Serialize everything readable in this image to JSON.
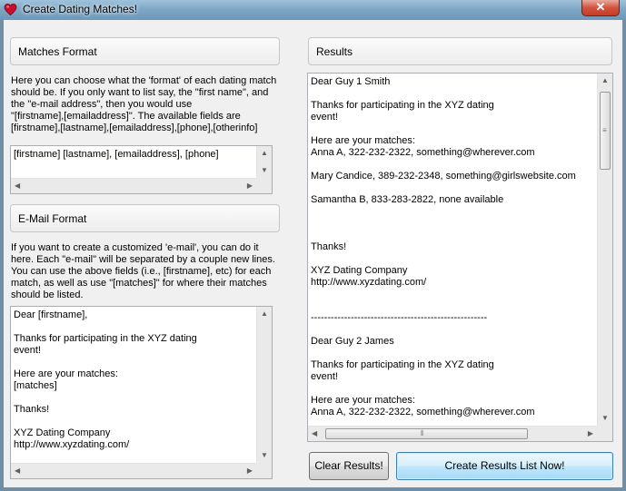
{
  "window": {
    "title": "Create Dating Matches!",
    "close_glyph": "✕"
  },
  "matches_format": {
    "header": "Matches Format",
    "description": "Here you can choose what the 'format' of each dating match\nshould be. If you only want to list say, the \"first name\", and\nthe \"e-mail address\", then you would use\n\"[firstname],[emailaddress]\". The available fields are\n[firstname],[lastname],[emailaddress],[phone],[otherinfo]",
    "value": "[firstname] [lastname], [emailaddress], [phone]"
  },
  "email_format": {
    "header": "E-Mail Format",
    "description": "If you want to create a customized 'e-mail', you can do it\nhere. Each \"e-mail\" will be separated by a couple new lines.\nYou can use the above fields (i.e., [firstname], etc) for each\nmatch, as well as use \"[matches]\" for where their matches\nshould be listed.",
    "value": "Dear [firstname],\n\nThanks for participating in the XYZ dating\nevent!\n\nHere are your matches:\n[matches]\n\nThanks!\n\nXYZ Dating Company\nhttp://www.xyzdating.com/"
  },
  "results": {
    "header": "Results",
    "value": "Dear Guy 1 Smith\n\nThanks for participating in the XYZ dating\nevent!\n\nHere are your matches:\nAnna A, 322-232-2322, something@wherever.com\n\nMary Candice, 389-232-2348, something@girlswebsite.com\n\nSamantha B, 833-283-2822, none available\n\n\n\nThanks!\n\nXYZ Dating Company\nhttp://www.xyzdating.com/\n\n\n-----------------------------------------------------\n\nDear Guy 2 James\n\nThanks for participating in the XYZ dating\nevent!\n\nHere are your matches:\nAnna A, 322-232-2322, something@wherever.com"
  },
  "buttons": {
    "clear": "Clear Results!",
    "create": "Create Results List Now!"
  },
  "colors": {
    "title_bar": "#7ea7c6",
    "close_button": "#c43c25",
    "app_icon": "#c8102e",
    "primary_button": "#bee6fd"
  },
  "icons": {
    "app": "heart-icon",
    "close": "close-icon"
  }
}
